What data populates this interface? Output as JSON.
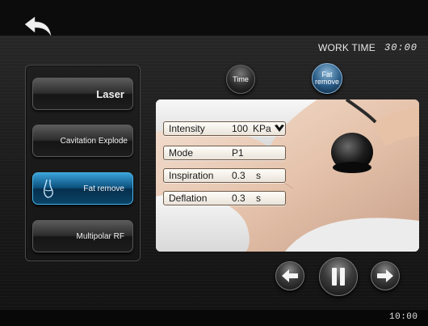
{
  "header": {
    "work_time_label": "WORK TIME",
    "work_time_value": "30:00"
  },
  "sidebar": {
    "items": [
      {
        "label": "Laser"
      },
      {
        "label": "Cavitation Explode"
      },
      {
        "label": "Fat remove",
        "selected": true
      },
      {
        "label": "Multipolar RF"
      }
    ]
  },
  "mode_buttons": {
    "time_label": "Time",
    "fat_remove_label": "Fat remove"
  },
  "params": {
    "intensity": {
      "label": "Intensity",
      "value": "100",
      "unit": "KPa"
    },
    "mode": {
      "label": "Mode",
      "value": "P1"
    },
    "inspiration": {
      "label": "Inspiration",
      "value": "0.3",
      "unit": "s"
    },
    "deflation": {
      "label": "Deflation",
      "value": "0.3",
      "unit": "s"
    }
  },
  "status": {
    "clock": "10:00"
  },
  "icons": [
    "back-arrow-icon",
    "fat-remove-icon",
    "chevron-down-icon",
    "arrow-left-icon",
    "pause-icon",
    "arrow-right-icon"
  ],
  "colors": {
    "accent": "#1e7fb8",
    "background": "#1a1a1a"
  }
}
